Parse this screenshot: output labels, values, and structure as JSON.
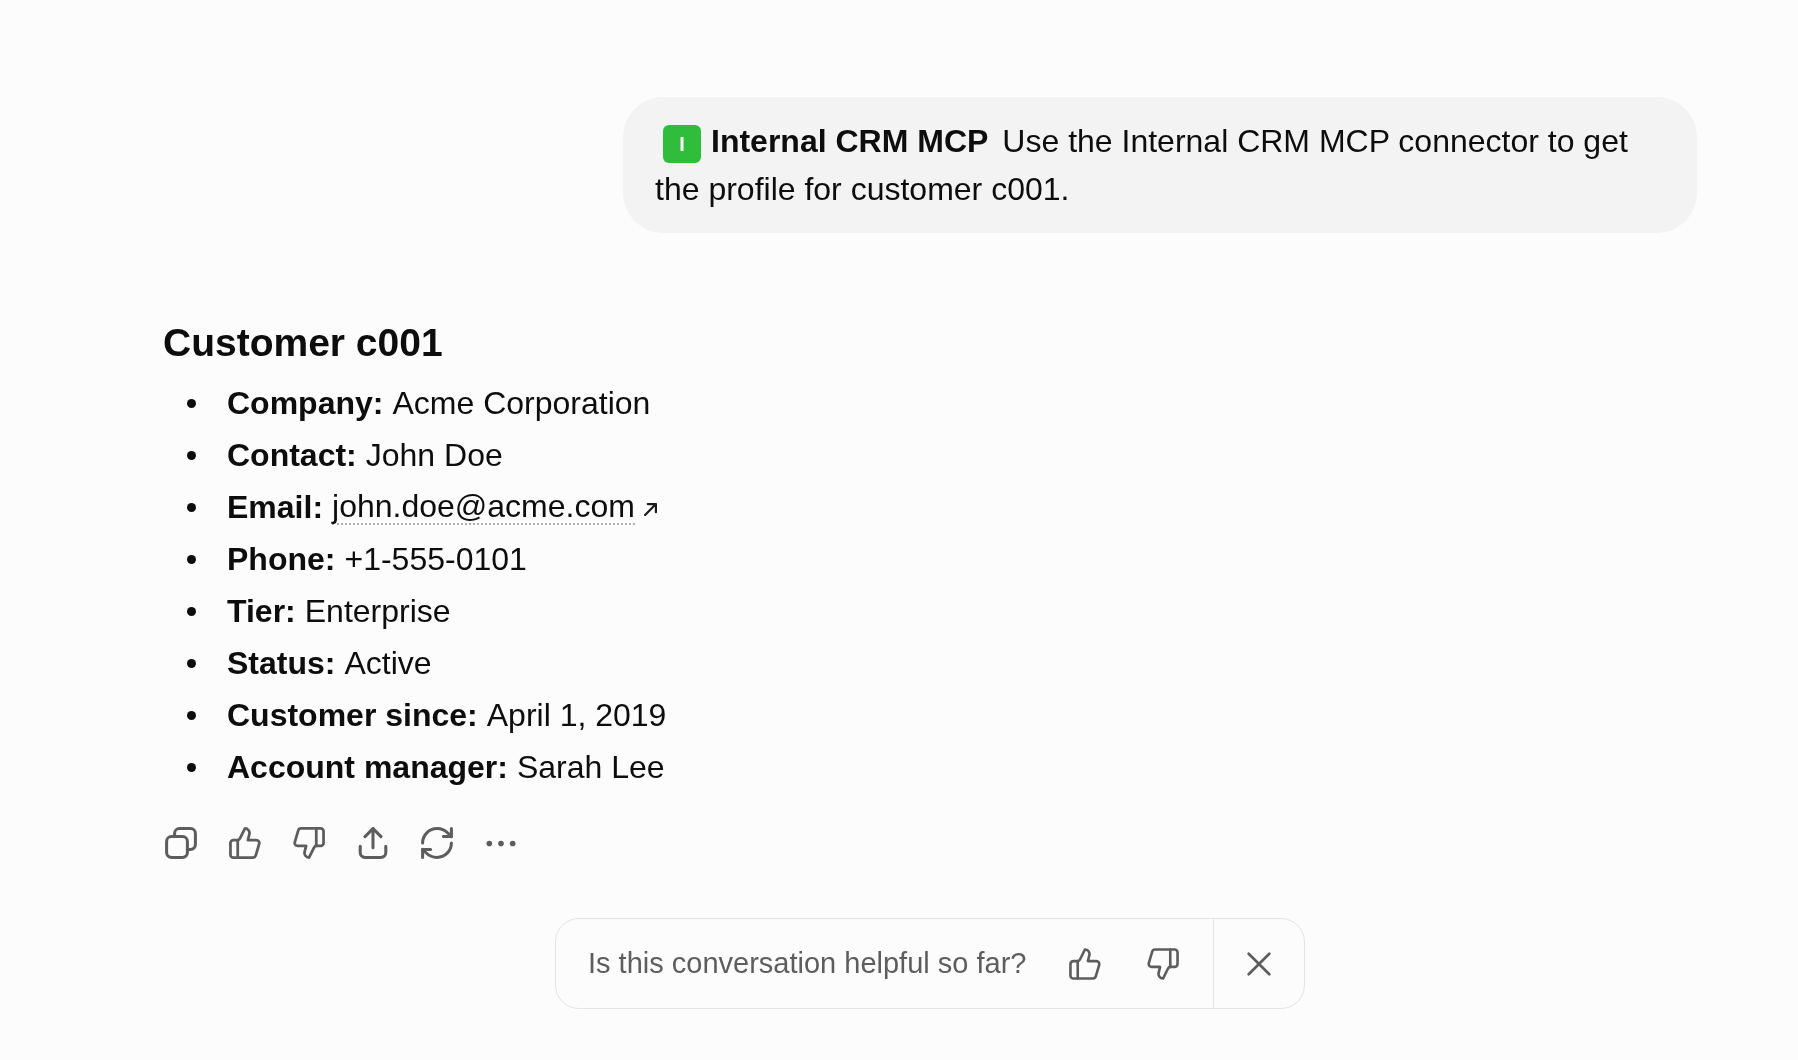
{
  "message": {
    "connector": {
      "badge": "I",
      "name": "Internal CRM MCP"
    },
    "text": "Use the Internal CRM MCP connector to get the profile for customer c001."
  },
  "response": {
    "title": "Customer c001",
    "fields": [
      {
        "kind": "text",
        "label": "Company:",
        "value": "Acme Corporation"
      },
      {
        "kind": "text",
        "label": "Contact:",
        "value": "John Doe"
      },
      {
        "kind": "link",
        "label": "Email:",
        "value": "john.doe@acme.com"
      },
      {
        "kind": "text",
        "label": "Phone:",
        "value": "+1-555-0101"
      },
      {
        "kind": "text",
        "label": "Tier:",
        "value": "Enterprise"
      },
      {
        "kind": "text",
        "label": "Status:",
        "value": "Active"
      },
      {
        "kind": "text",
        "label": "Customer since:",
        "value": "April 1, 2019"
      },
      {
        "kind": "text",
        "label": "Account manager:",
        "value": "Sarah Lee"
      }
    ]
  },
  "feedback": {
    "question": "Is this conversation helpful so far?"
  }
}
